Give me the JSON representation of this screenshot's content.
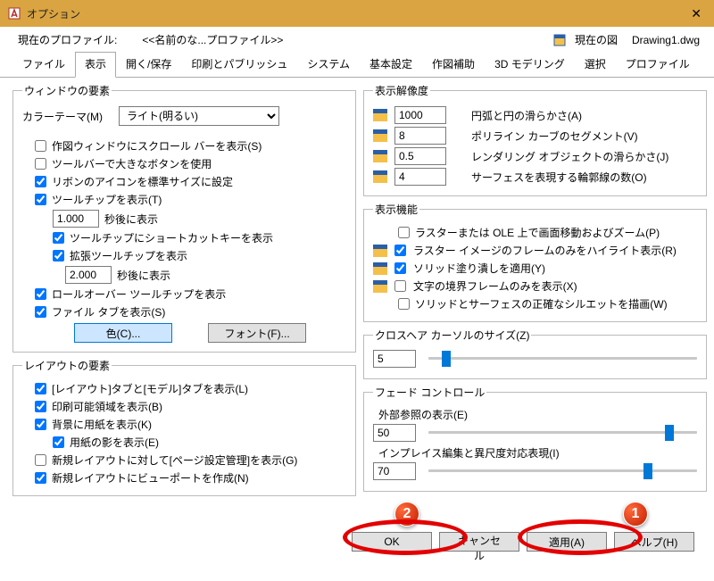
{
  "window": {
    "title": "オプション",
    "close": "✕"
  },
  "profile": {
    "label": "現在のプロファイル:",
    "value": "<<名前のな...プロファイル>>",
    "doc_label": "現在の図",
    "doc_name": "Drawing1.dwg"
  },
  "tabs": [
    "ファイル",
    "表示",
    "開く/保存",
    "印刷とパブリッシュ",
    "システム",
    "基本設定",
    "作図補助",
    "3D モデリング",
    "選択",
    "プロファイル"
  ],
  "window_elements": {
    "legend": "ウィンドウの要素",
    "theme_label": "カラーテーマ(M)",
    "theme_value": "ライト(明るい)",
    "scrollbar": "作図ウィンドウにスクロール バーを表示(S)",
    "big_buttons": "ツールバーで大きなボタンを使用",
    "std_icons": "リボンのアイコンを標準サイズに設定",
    "tooltip": "ツールチップを表示(T)",
    "tooltip_delay_value": "1.000",
    "tooltip_delay_label": "秒後に表示",
    "tooltip_shortcut": "ツールチップにショートカットキーを表示",
    "tooltip_ext": "拡張ツールチップを表示",
    "tooltip_ext_delay_value": "2.000",
    "tooltip_ext_delay_label": "秒後に表示",
    "rollover": "ロールオーバー ツールチップを表示",
    "filetabs": "ファイル タブを表示(S)",
    "btn_color": "色(C)...",
    "btn_font": "フォント(F)..."
  },
  "layout_elements": {
    "legend": "レイアウトの要素",
    "layout_model": "[レイアウト]タブと[モデル]タブを表示(L)",
    "print_area": "印刷可能領域を表示(B)",
    "paper_bg": "背景に用紙を表示(K)",
    "paper_shadow": "用紙の影を表示(E)",
    "page_setup": "新規レイアウトに対して[ページ設定管理]を表示(G)",
    "viewport": "新規レイアウトにビューポートを作成(N)"
  },
  "resolution": {
    "legend": "表示解像度",
    "r1_value": "1000",
    "r1_label": "円弧と円の滑らかさ(A)",
    "r2_value": "8",
    "r2_label": "ポリライン カーブのセグメント(V)",
    "r3_value": "0.5",
    "r3_label": "レンダリング オブジェクトの滑らかさ(J)",
    "r4_value": "4",
    "r4_label": "サーフェスを表現する輪郭線の数(O)"
  },
  "performance": {
    "legend": "表示機能",
    "p1": "ラスターまたは OLE 上で画面移動およびズーム(P)",
    "p2": "ラスター イメージのフレームのみをハイライト表示(R)",
    "p3": "ソリッド塗り潰しを適用(Y)",
    "p4": "文字の境界フレームのみを表示(X)",
    "p5": "ソリッドとサーフェスの正確なシルエットを描画(W)"
  },
  "crosshair": {
    "label": "クロスヘア カーソルのサイズ(Z)",
    "value": "5",
    "pct": 5
  },
  "fade": {
    "legend": "フェード コントロール",
    "xref_label": "外部参照の表示(E)",
    "xref_value": "50",
    "xref_pct": 88,
    "inplace_label": "インプレイス編集と異尺度対応表現(I)",
    "inplace_value": "70",
    "inplace_pct": 80
  },
  "footer": {
    "ok": "OK",
    "cancel": "キャンセル",
    "apply": "適用(A)",
    "help": "ヘルプ(H)"
  },
  "markers": {
    "m1": "1",
    "m2": "2"
  }
}
